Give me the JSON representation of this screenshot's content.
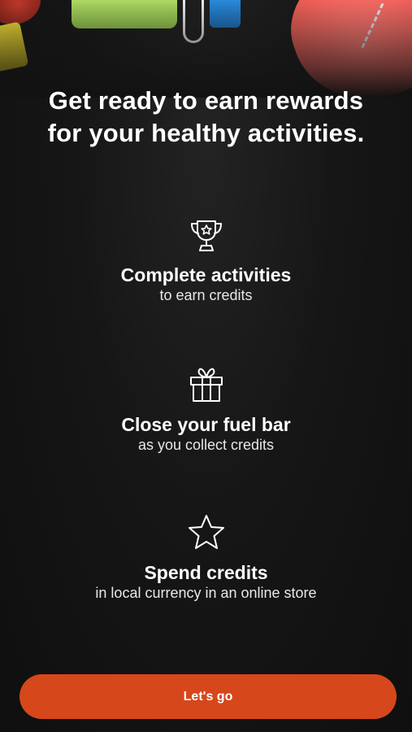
{
  "headline": {
    "line1": "Get ready to earn rewards",
    "line2": "for your healthy activities."
  },
  "features": [
    {
      "icon": "trophy-icon",
      "title": "Complete activities",
      "subtitle": "to earn credits"
    },
    {
      "icon": "gift-icon",
      "title": "Close your fuel bar",
      "subtitle": "as you collect credits"
    },
    {
      "icon": "star-icon",
      "title": "Spend credits",
      "subtitle": "in local currency in an online store"
    }
  ],
  "cta": {
    "label": "Let's go"
  },
  "colors": {
    "background": "#121212",
    "accent": "#d6471b",
    "text": "#ffffff"
  }
}
